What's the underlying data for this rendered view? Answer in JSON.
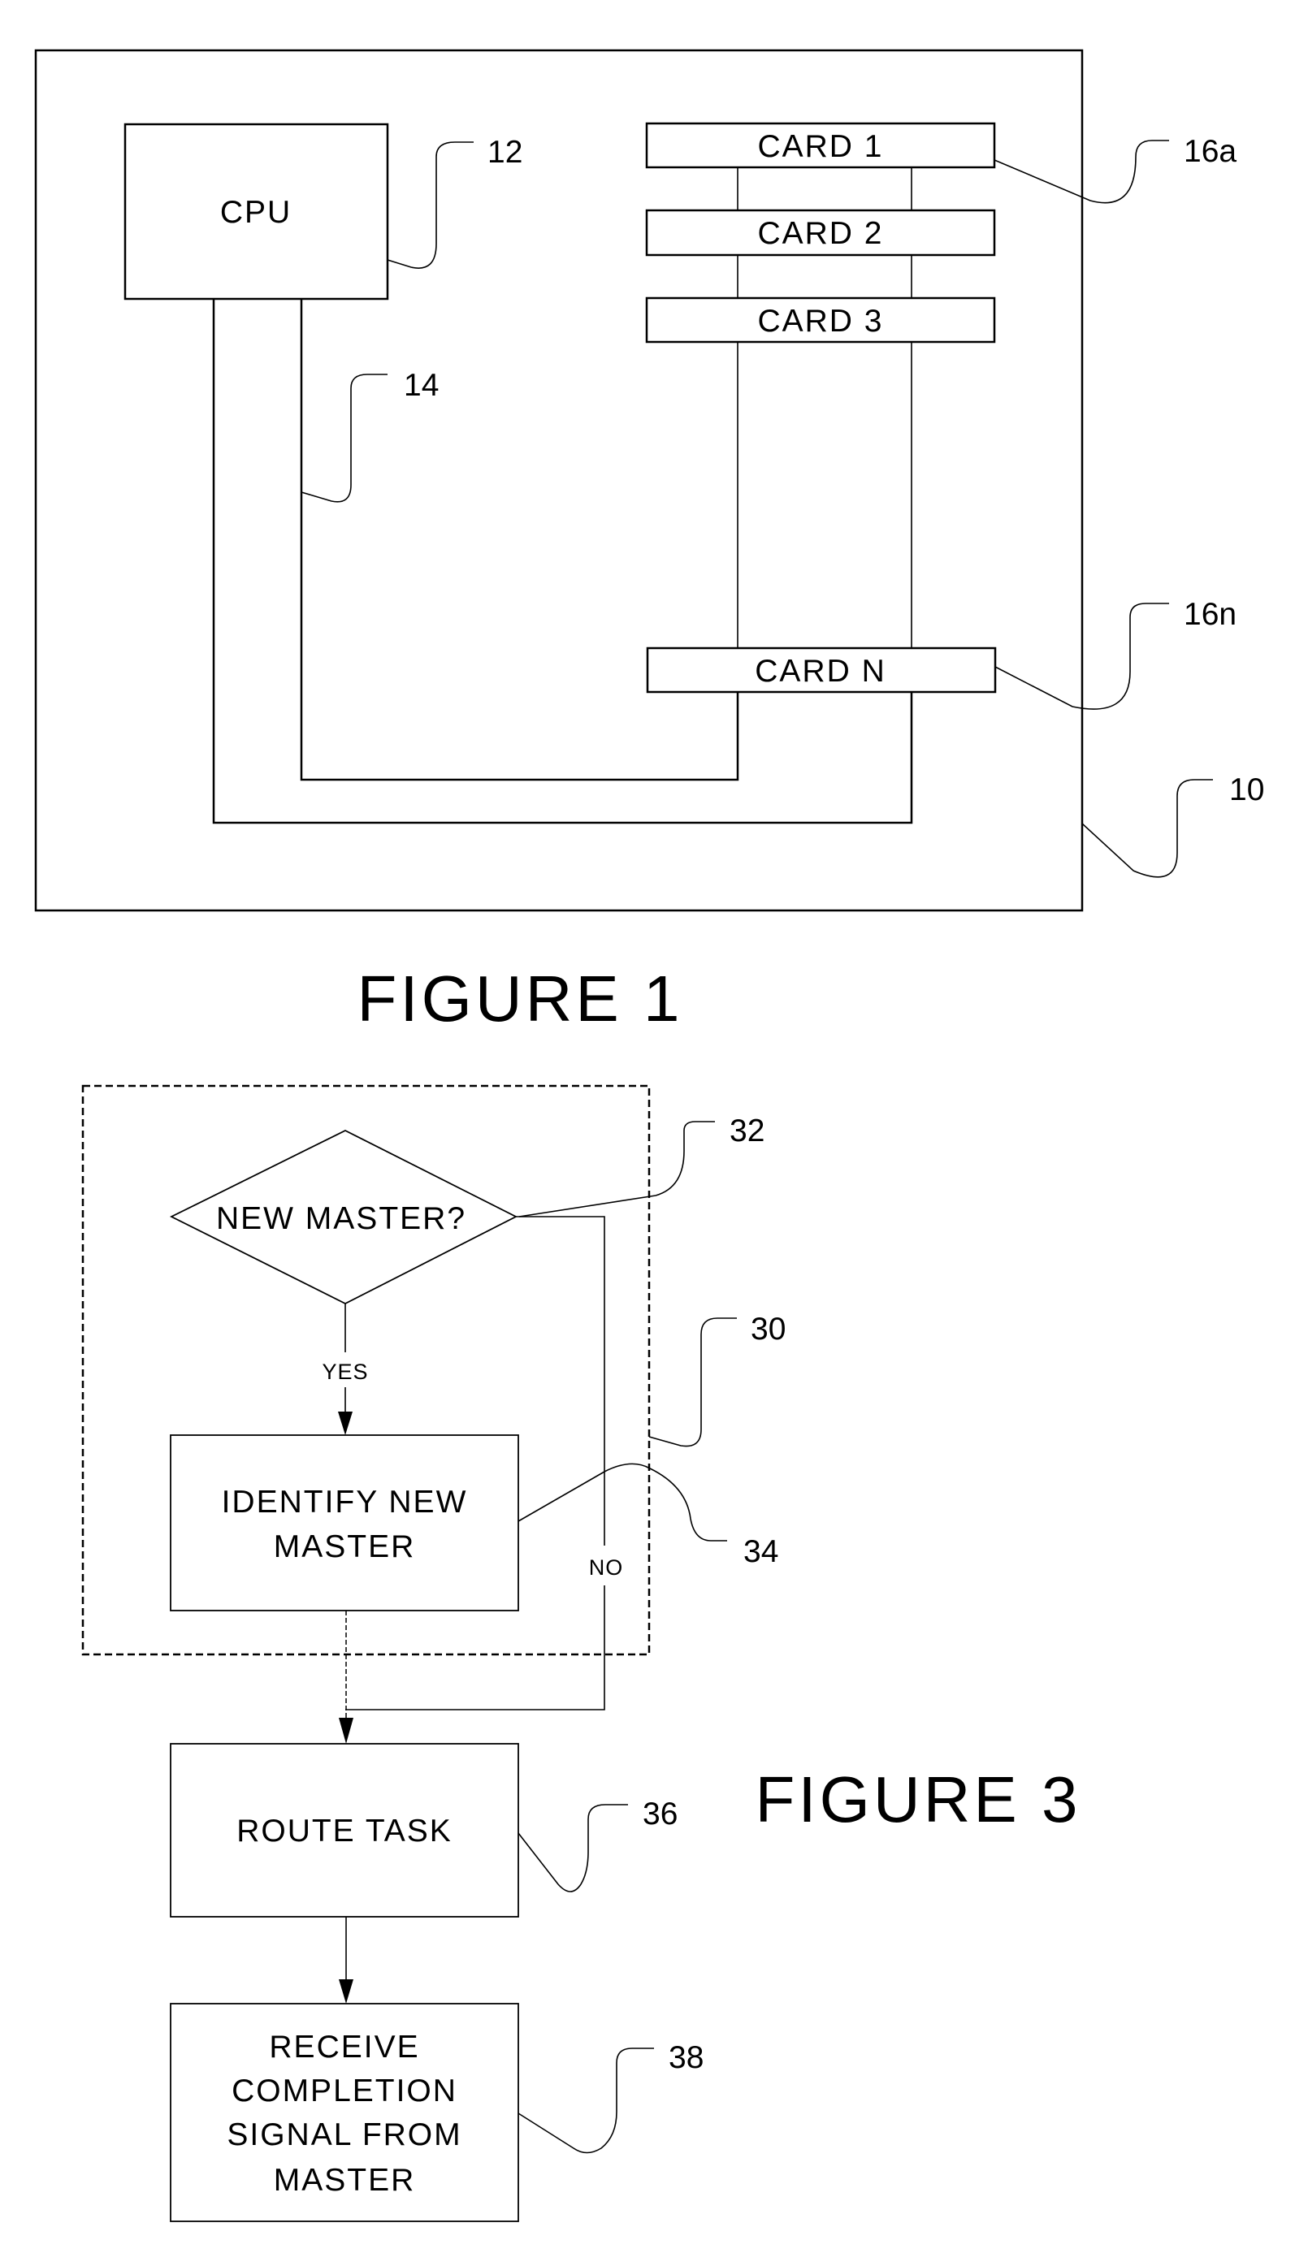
{
  "figure1": {
    "caption": "FIGURE 1",
    "cpu_label": "CPU",
    "cards": [
      {
        "label": "CARD 1"
      },
      {
        "label": "CARD 2"
      },
      {
        "label": "CARD 3"
      },
      {
        "label": "CARD N"
      }
    ],
    "reference_numerals": {
      "system": "10",
      "cpu": "12",
      "bus": "14",
      "card_first": "16a",
      "card_last": "16n"
    }
  },
  "figure3": {
    "caption": "FIGURE 3",
    "decision": {
      "label": "NEW MASTER?",
      "yes_label": "YES",
      "no_label": "NO"
    },
    "steps": {
      "identify": [
        "IDENTIFY NEW",
        "MASTER"
      ],
      "route": [
        "ROUTE TASK"
      ],
      "receive": [
        "RECEIVE",
        "COMPLETION",
        "SIGNAL FROM",
        "MASTER"
      ]
    },
    "reference_numerals": {
      "group": "30",
      "decision": "32",
      "identify": "34",
      "route": "36",
      "receive": "38"
    }
  }
}
